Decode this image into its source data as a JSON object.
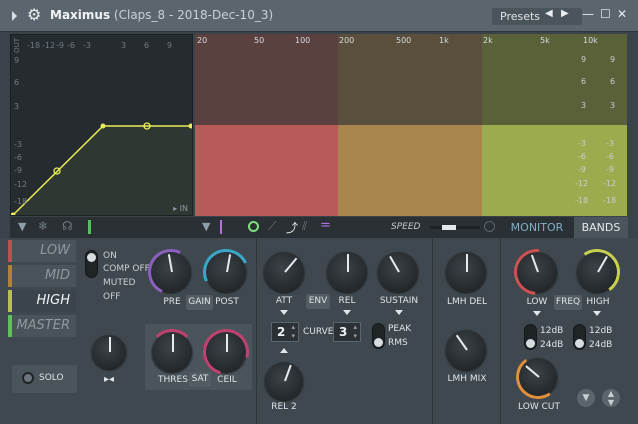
{
  "window": {
    "app_name": "Maximus",
    "subtitle": "(Claps_8 - 2018-Dec-10_3)",
    "presets_label": "Presets"
  },
  "envelope": {
    "out_label": "OUT",
    "in_label": "IN",
    "x_ticks": [
      "-18",
      "-12",
      "-9",
      "-6",
      "-3",
      "3",
      "6",
      "9"
    ],
    "y_ticks": [
      "9",
      "6",
      "3",
      "-3",
      "-6",
      "-9",
      "-12",
      "-18"
    ]
  },
  "spectrum": {
    "freq_labels": [
      "20",
      "50",
      "100",
      "200",
      "500",
      "1k",
      "2k",
      "5k",
      "10k"
    ],
    "db_labels": [
      "9",
      "6",
      "3",
      "-3",
      "-6",
      "-9",
      "-12",
      "-18"
    ],
    "right_db_labels": [
      "9",
      "6",
      "3",
      "-3",
      "-6",
      "-9",
      "-12",
      "-18"
    ],
    "colors": {
      "low_top": "#5b4040",
      "mid_top": "#5a4f3c",
      "high_top": "#5a6038",
      "low_bottom": "#b85a58",
      "mid_bottom": "#a9864e",
      "high_bottom": "#9cab4e"
    }
  },
  "toolbar": {
    "speed_label": "SPEED",
    "monitor_label": "MONITOR",
    "bands_label": "BANDS"
  },
  "bands": [
    {
      "label": "LOW",
      "color": "#c05050"
    },
    {
      "label": "MID",
      "color": "#b08040"
    },
    {
      "label": "HIGH",
      "color": "#b8c050"
    },
    {
      "label": "MASTER",
      "color": "#60c060"
    }
  ],
  "band_modes": [
    "ON",
    "COMP OFF",
    "MUTED",
    "OFF"
  ],
  "solo_label": "SOLO",
  "knobs": {
    "pre": "PRE",
    "gain": "GAIN",
    "post": "POST",
    "thres": "THRES",
    "sat": "SAT",
    "ceil": "CEIL",
    "att": "ATT",
    "env": "ENV",
    "rel": "REL",
    "sustain": "SUSTAIN",
    "curve": "CURVE",
    "rel2": "REL 2",
    "peak": "PEAK",
    "rms": "RMS",
    "lmh_del": "LMH DEL",
    "lmh_mix": "LMH MIX",
    "low": "LOW",
    "freq": "FREQ",
    "high": "HIGH",
    "low_cut": "LOW CUT"
  },
  "spin_values": {
    "att_curve": "2",
    "rel_curve": "3"
  },
  "slopes": {
    "low_12": "12dB",
    "low_24": "24dB",
    "high_12": "12dB",
    "high_24": "24dB"
  }
}
